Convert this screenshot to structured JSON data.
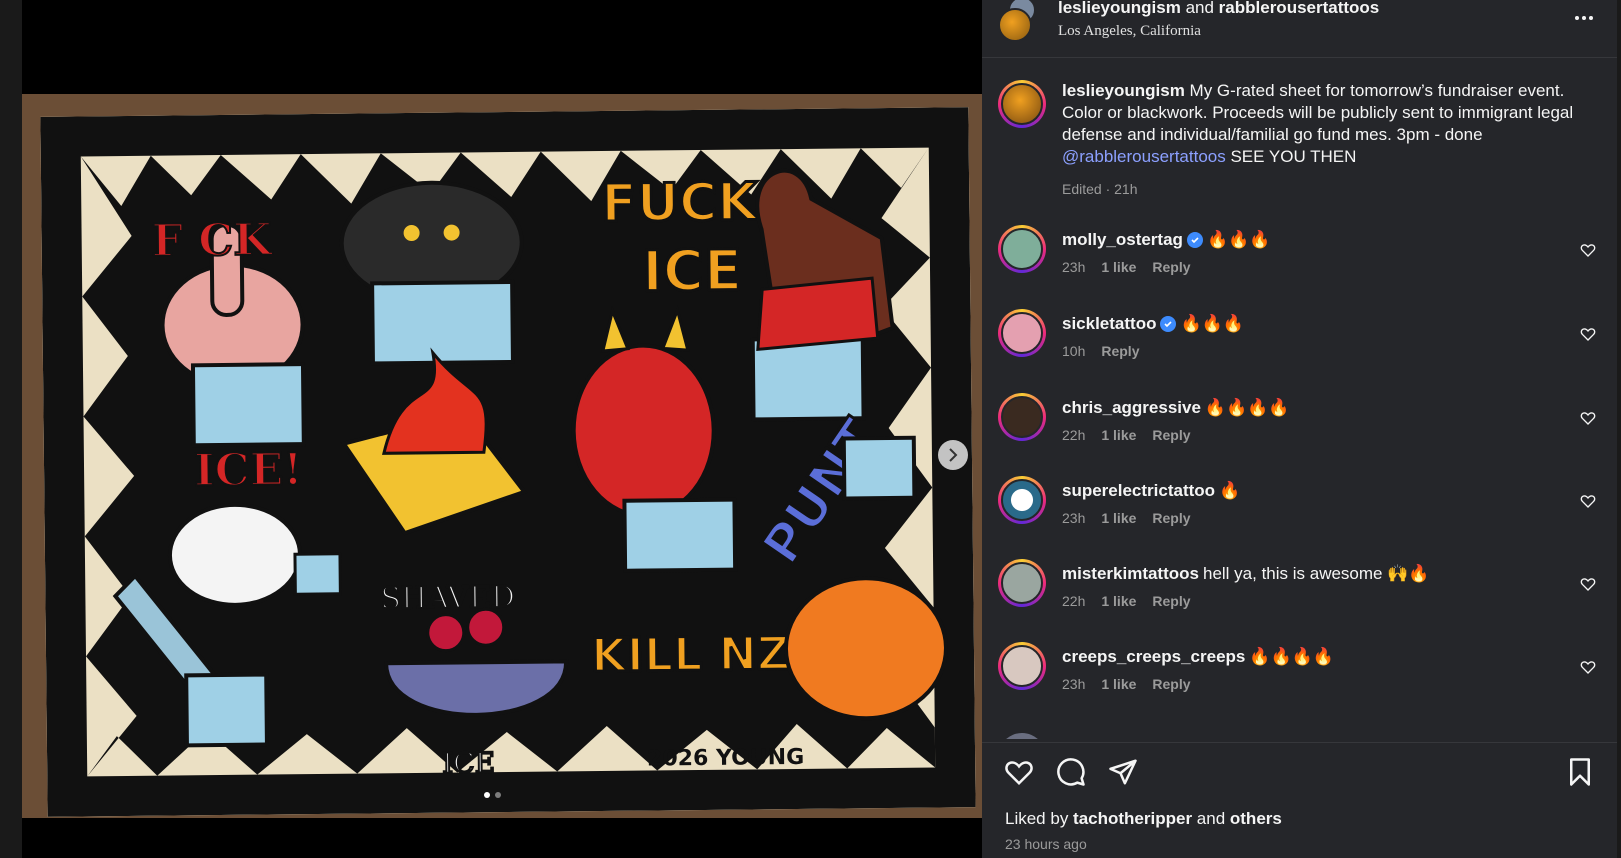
{
  "post": {
    "author": "leslieyoungism",
    "conjunction": "and",
    "collaborator": "rabblerousertattoos",
    "location": "Los Angeles, California"
  },
  "caption": {
    "username": "leslieyoungism",
    "text": " My G-rated sheet for tomorrow’s fundraiser event. Color or blackwork. Proceeds will be publicly sent to immigrant legal defense and individual/familial go fund mes. 3pm - done ",
    "mention": "@rabblerousertattoos",
    "text_after": " SEE YOU THEN",
    "meta": "Edited · 21h"
  },
  "comments": [
    {
      "username": "molly_ostertag",
      "verified": true,
      "text": "🔥🔥🔥",
      "time": "23h",
      "likes": "1 like",
      "reply": "Reply"
    },
    {
      "username": "sickletattoo",
      "verified": true,
      "text": "🔥🔥🔥",
      "time": "10h",
      "likes": "",
      "reply": "Reply"
    },
    {
      "username": "chris_aggressive",
      "verified": false,
      "text": "🔥🔥🔥🔥",
      "time": "22h",
      "likes": "1 like",
      "reply": "Reply"
    },
    {
      "username": "superelectrictattoo",
      "verified": false,
      "text": "🔥",
      "time": "23h",
      "likes": "1 like",
      "reply": "Reply"
    },
    {
      "username": "misterkimtattoos",
      "verified": false,
      "text": "hell ya, this is awesome 🙌🔥",
      "time": "22h",
      "likes": "1 like",
      "reply": "Reply"
    },
    {
      "username": "creeps_creeps_creeps",
      "verified": false,
      "text": "🔥🔥🔥🔥",
      "time": "23h",
      "likes": "1 like",
      "reply": "Reply"
    }
  ],
  "flash_text": {
    "fck": "F CK",
    "ice_bang": "ICE!",
    "fuck": "FUCK",
    "ice": "ICE",
    "punt": "PUNT",
    "shaved": "SHAVED",
    "ice_small": "ICE",
    "kill_nzs": "KILL NZS",
    "signature": "2026 YOUNG"
  },
  "likes": {
    "prefix": "Liked by ",
    "user": "tachotheripper",
    "and": " and ",
    "others": "others"
  },
  "timestamp": "23 hours ago",
  "carousel": {
    "count": 2,
    "active": 0
  },
  "colors": {
    "panel_bg": "#25262a",
    "link": "#8ca0ff",
    "muted": "#9b9b9b",
    "verified": "#3d8bfd"
  },
  "icons": {
    "more": "more-horizontal-icon",
    "like": "heart-icon",
    "comment": "comment-bubble-icon",
    "share": "paper-plane-icon",
    "save": "bookmark-icon",
    "next": "chevron-right-icon"
  }
}
